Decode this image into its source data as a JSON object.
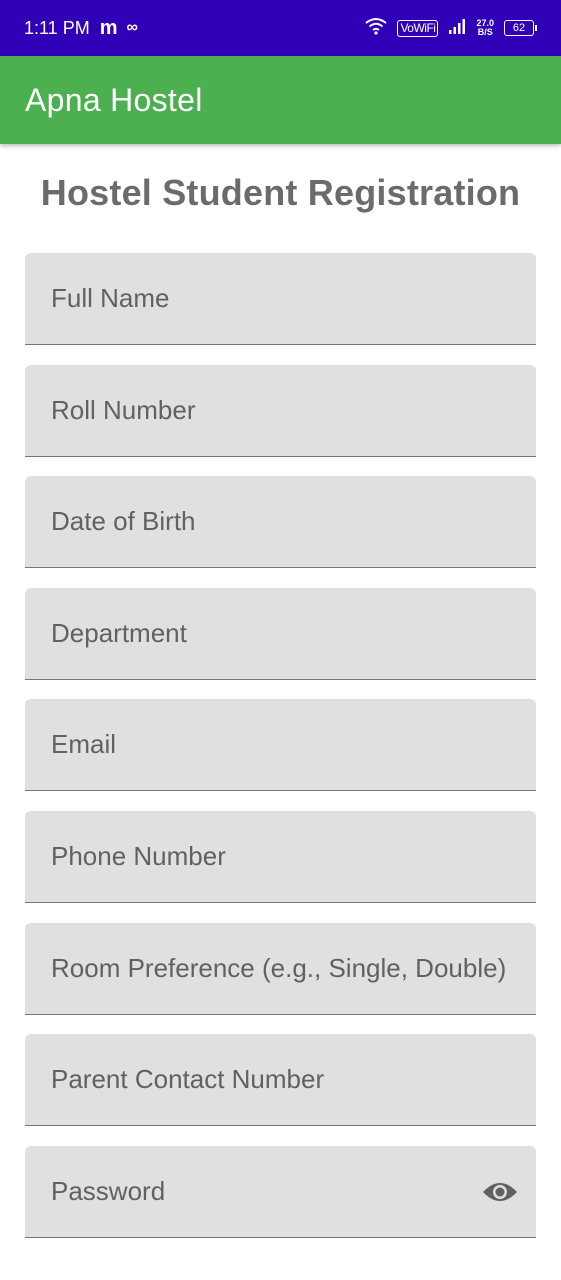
{
  "status_bar": {
    "time": "1:11 PM",
    "app_icon_m": "m",
    "app_icon_inf": "∞",
    "vowifi": "VoWiFi",
    "speed_value": "27.0",
    "speed_unit": "B/S",
    "battery": "62"
  },
  "app_bar": {
    "title": "Apna Hostel"
  },
  "page": {
    "heading": "Hostel Student Registration"
  },
  "form": {
    "fields": [
      {
        "hint": "Full Name"
      },
      {
        "hint": "Roll Number"
      },
      {
        "hint": "Date of Birth"
      },
      {
        "hint": "Department"
      },
      {
        "hint": "Email"
      },
      {
        "hint": "Phone Number"
      },
      {
        "hint": "Room Preference (e.g., Single, Double)"
      },
      {
        "hint": "Parent Contact Number"
      },
      {
        "hint": "Password"
      }
    ],
    "password_toggle_icon": "eye-icon"
  },
  "colors": {
    "status_bar": "#3000b8",
    "app_bar": "#4caf50",
    "field_bg": "#e0e0e0",
    "hint_text": "#616161",
    "heading_text": "#6b6b6b"
  }
}
